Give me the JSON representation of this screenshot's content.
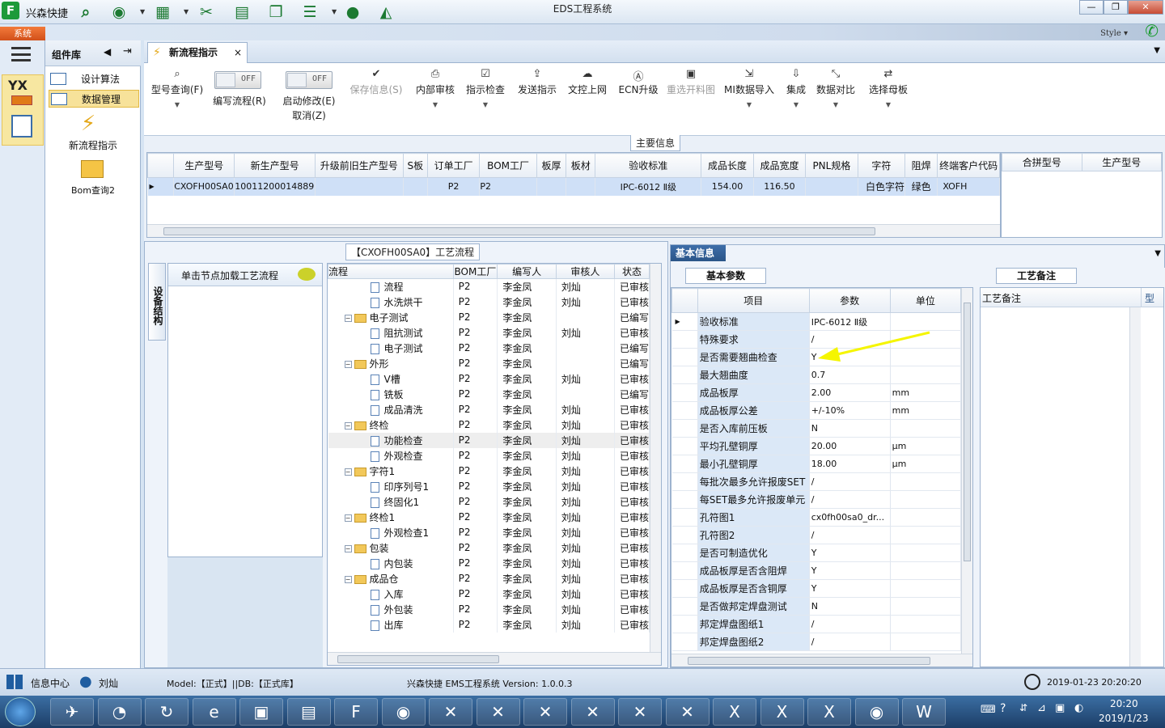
{
  "app": {
    "name": "兴森快捷",
    "window_title": "EDS工程系统",
    "system_tab": "系统",
    "style_label": "Style"
  },
  "window_controls": {
    "minimize": "—",
    "restore": "❐",
    "close": "✕"
  },
  "toolbar_icons": [
    "search-icon",
    "globe-icon",
    "table-icon",
    "scissors-icon",
    "film-icon",
    "copy-icon",
    "list-icon",
    "user-icon",
    "chart-icon"
  ],
  "component_panel": {
    "title": "组件库",
    "items": [
      {
        "label": "设计算法"
      },
      {
        "label": "数据管理"
      }
    ],
    "large_items": [
      {
        "label": "新流程指示"
      },
      {
        "label": "Bom查询2"
      }
    ]
  },
  "tab": {
    "label": "新流程指示",
    "close": "×"
  },
  "ribbon": {
    "query": {
      "label": "型号查询(F)"
    },
    "edit_flow": {
      "toggle": "OFF",
      "label": "编写流程(R)"
    },
    "start_modify": {
      "toggle": "OFF",
      "label": "启动修改(E)",
      "sublabel": "取消(Z)"
    },
    "buttons": [
      {
        "label": "保存信息(S)",
        "disabled": true,
        "icon": "check-icon"
      },
      {
        "label": "内部审核",
        "disabled": false,
        "icon": "printer-icon"
      },
      {
        "label": "指示检查",
        "disabled": false,
        "icon": "checkbox-icon"
      },
      {
        "label": "发送指示",
        "disabled": false,
        "icon": "upload-icon"
      },
      {
        "label": "文控上网",
        "disabled": false,
        "icon": "cloud-upload-icon"
      },
      {
        "label": "ECN升级",
        "disabled": false,
        "icon": "ecn-icon"
      },
      {
        "label": "重选开料图",
        "disabled": true,
        "icon": "image-icon"
      },
      {
        "label": "MI数据导入",
        "disabled": false,
        "icon": "import-icon"
      },
      {
        "label": "集成",
        "disabled": false,
        "icon": "download-icon"
      },
      {
        "label": "数据对比",
        "disabled": false,
        "icon": "compare-icon"
      },
      {
        "label": "选择母板",
        "disabled": false,
        "icon": "shuffle-icon"
      }
    ]
  },
  "main_info": {
    "title": "主要信息",
    "columns": [
      "生产型号",
      "新生产型号",
      "升级前旧生产型号",
      "S板",
      "订单工厂",
      "BOM工厂",
      "板厚",
      "板材",
      "验收标准",
      "成品长度",
      "成品宽度",
      "PNL规格",
      "字符",
      "阻焊",
      "终端客户代码"
    ],
    "row": [
      "CXOFH00SA0",
      "10011200014889",
      "",
      "",
      "P2",
      "P2",
      "",
      "",
      "IPC-6012 Ⅱ级",
      "154.00",
      "116.50",
      "",
      "白色字符",
      "绿色",
      "XOFH"
    ],
    "side_columns": [
      "合拼型号",
      "生产型号"
    ]
  },
  "process": {
    "title": "【CXOFH00SA0】工艺流程",
    "side_tab": "设备结构",
    "hint": "单击节点加载工艺流程",
    "columns": [
      "流程",
      "BOM工厂",
      "编写人",
      "审核人",
      "状态"
    ],
    "rows": [
      {
        "level": 2,
        "type": "doc",
        "name": "流程",
        "factory": "P2",
        "writer": "李金凤",
        "reviewer": "刘灿",
        "status": "已审核"
      },
      {
        "level": 2,
        "type": "doc",
        "name": "水洗烘干",
        "factory": "P2",
        "writer": "李金凤",
        "reviewer": "刘灿",
        "status": "已审核"
      },
      {
        "level": 1,
        "type": "folder",
        "name": "电子测试",
        "factory": "P2",
        "writer": "李金凤",
        "reviewer": "",
        "status": "已编写"
      },
      {
        "level": 2,
        "type": "doc",
        "name": "阻抗测试",
        "factory": "P2",
        "writer": "李金凤",
        "reviewer": "刘灿",
        "status": "已审核"
      },
      {
        "level": 2,
        "type": "doc",
        "name": "电子测试",
        "factory": "P2",
        "writer": "李金凤",
        "reviewer": "",
        "status": "已编写"
      },
      {
        "level": 1,
        "type": "folder",
        "name": "外形",
        "factory": "P2",
        "writer": "李金凤",
        "reviewer": "",
        "status": "已编写"
      },
      {
        "level": 2,
        "type": "doc",
        "name": "V槽",
        "factory": "P2",
        "writer": "李金凤",
        "reviewer": "刘灿",
        "status": "已审核"
      },
      {
        "level": 2,
        "type": "doc",
        "name": "铣板",
        "factory": "P2",
        "writer": "李金凤",
        "reviewer": "",
        "status": "已编写"
      },
      {
        "level": 2,
        "type": "doc",
        "name": "成品清洗",
        "factory": "P2",
        "writer": "李金凤",
        "reviewer": "刘灿",
        "status": "已审核"
      },
      {
        "level": 1,
        "type": "folder",
        "name": "终检",
        "factory": "P2",
        "writer": "李金凤",
        "reviewer": "刘灿",
        "status": "已审核"
      },
      {
        "level": 2,
        "type": "doc",
        "name": "功能检查",
        "factory": "P2",
        "writer": "李金凤",
        "reviewer": "刘灿",
        "status": "已审核",
        "hl": true
      },
      {
        "level": 2,
        "type": "doc",
        "name": "外观检查",
        "factory": "P2",
        "writer": "李金凤",
        "reviewer": "刘灿",
        "status": "已审核"
      },
      {
        "level": 1,
        "type": "folder",
        "name": "字符1",
        "factory": "P2",
        "writer": "李金凤",
        "reviewer": "刘灿",
        "status": "已审核"
      },
      {
        "level": 2,
        "type": "doc",
        "name": "印序列号1",
        "factory": "P2",
        "writer": "李金凤",
        "reviewer": "刘灿",
        "status": "已审核"
      },
      {
        "level": 2,
        "type": "doc",
        "name": "终固化1",
        "factory": "P2",
        "writer": "李金凤",
        "reviewer": "刘灿",
        "status": "已审核"
      },
      {
        "level": 1,
        "type": "folder",
        "name": "终检1",
        "factory": "P2",
        "writer": "李金凤",
        "reviewer": "刘灿",
        "status": "已审核"
      },
      {
        "level": 2,
        "type": "doc",
        "name": "外观检查1",
        "factory": "P2",
        "writer": "李金凤",
        "reviewer": "刘灿",
        "status": "已审核"
      },
      {
        "level": 1,
        "type": "folder",
        "name": "包装",
        "factory": "P2",
        "writer": "李金凤",
        "reviewer": "刘灿",
        "status": "已审核"
      },
      {
        "level": 2,
        "type": "doc",
        "name": "内包装",
        "factory": "P2",
        "writer": "李金凤",
        "reviewer": "刘灿",
        "status": "已审核"
      },
      {
        "level": 1,
        "type": "folder",
        "name": "成品仓",
        "factory": "P2",
        "writer": "李金凤",
        "reviewer": "刘灿",
        "status": "已审核"
      },
      {
        "level": 2,
        "type": "doc",
        "name": "入库",
        "factory": "P2",
        "writer": "李金凤",
        "reviewer": "刘灿",
        "status": "已审核"
      },
      {
        "level": 2,
        "type": "doc",
        "name": "外包装",
        "factory": "P2",
        "writer": "李金凤",
        "reviewer": "刘灿",
        "status": "已审核"
      },
      {
        "level": 2,
        "type": "doc",
        "name": "出库",
        "factory": "P2",
        "writer": "李金凤",
        "reviewer": "刘灿",
        "status": "已审核"
      }
    ]
  },
  "basic_info": {
    "title": "基本信息",
    "subtab": "基本参数",
    "columns": [
      "项目",
      "参数",
      "单位"
    ],
    "rows": [
      [
        "验收标准",
        "IPC-6012 Ⅱ级",
        ""
      ],
      [
        "特殊要求",
        "/",
        ""
      ],
      [
        "是否需要翘曲检查",
        "Y",
        ""
      ],
      [
        "最大翘曲度",
        "0.7",
        ""
      ],
      [
        "成品板厚",
        "2.00",
        "mm"
      ],
      [
        "成品板厚公差",
        "+/-10%",
        "mm"
      ],
      [
        "是否入库前压板",
        "N",
        ""
      ],
      [
        "平均孔壁铜厚",
        "20.00",
        "μm"
      ],
      [
        "最小孔壁铜厚",
        "18.00",
        "μm"
      ],
      [
        "每批次最多允许报废SET",
        "/",
        ""
      ],
      [
        "每SET最多允许报废单元",
        "/",
        ""
      ],
      [
        "孔符图1",
        "cx0fh00sa0_dr...",
        ""
      ],
      [
        "孔符图2",
        "/",
        ""
      ],
      [
        "是否可制造优化",
        "Y",
        ""
      ],
      [
        "成品板厚是否含阻焊",
        "Y",
        ""
      ],
      [
        "成品板厚是否含铜厚",
        "Y",
        ""
      ],
      [
        "是否做邦定焊盘测试",
        "N",
        ""
      ],
      [
        "邦定焊盘图纸1",
        "/",
        ""
      ],
      [
        "邦定焊盘图纸2",
        "/",
        ""
      ]
    ]
  },
  "remarks": {
    "title": "工艺备注",
    "column": "工艺备注",
    "column2": "型"
  },
  "status": {
    "info_center": "信息中心",
    "user": "刘灿",
    "model_db": "Model:【正式】||DB:【正式库】",
    "version": "兴森快捷  EMS工程系统  Version: 1.0.0.3",
    "datetime": "2019-01-23 20:20:20"
  },
  "taskbar": {
    "time": "20:20",
    "date": "2019/1/23"
  },
  "colors": {
    "accent": "#2b5588",
    "selection": "#cfe0f7",
    "highlight": "#f7e29a",
    "arrow": "#f5f500"
  }
}
